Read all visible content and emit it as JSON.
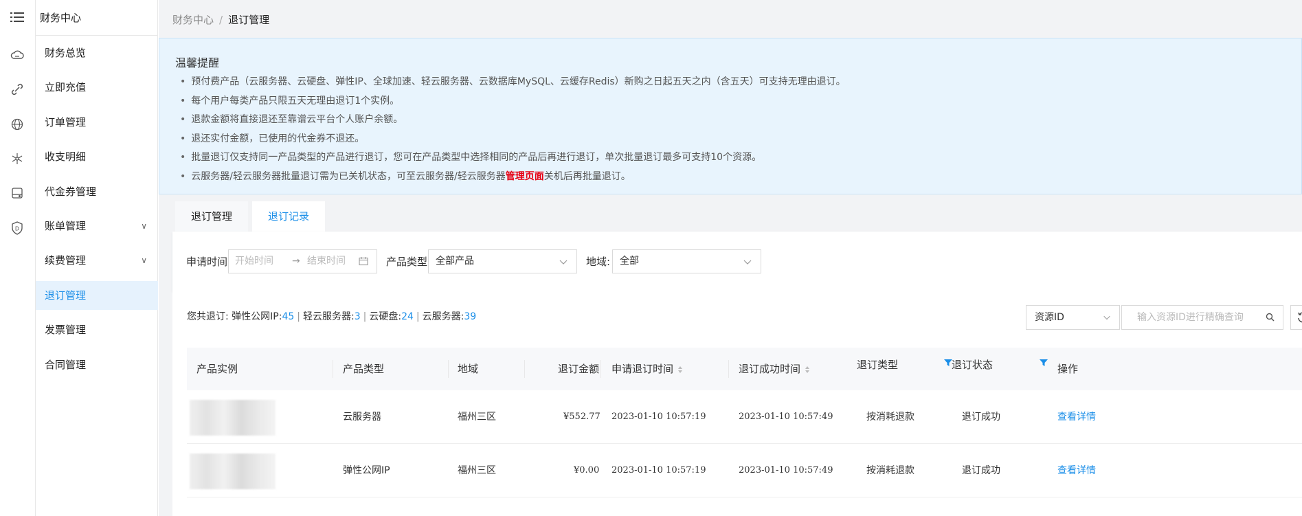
{
  "rail_icons": [
    "menu-icon",
    "cloud-icon",
    "link-icon",
    "globe-icon",
    "network-icon",
    "disk-icon",
    "shield-icon"
  ],
  "nav": {
    "title": "财务中心",
    "items": [
      {
        "label": "财务总览"
      },
      {
        "label": "立即充值"
      },
      {
        "label": "订单管理"
      },
      {
        "label": "收支明细"
      },
      {
        "label": "代金券管理"
      },
      {
        "label": "账单管理",
        "expand": "∨"
      },
      {
        "label": "续费管理",
        "expand": "∨"
      },
      {
        "label": "退订管理"
      },
      {
        "label": "发票管理"
      },
      {
        "label": "合同管理"
      }
    ]
  },
  "breadcrumb": {
    "root": "财务中心",
    "sep": "/",
    "current": "退订管理"
  },
  "notice": {
    "title": "温馨提醒",
    "items": [
      "预付费产品（云服务器、云硬盘、弹性IP、全球加速、轻云服务器、云数据库MySQL、云缓存Redis）新购之日起五天之内（含五天）可支持无理由退订。",
      "每个用户每类产品只限五天无理由退订1个实例。",
      "退款金额将直接退还至靠谱云平台个人账户余额。",
      "退还实付金额，已使用的代金券不退还。",
      "批量退订仅支持同一产品类型的产品进行退订，您可在产品类型中选择相同的产品后再进行退订，单次批量退订最多可支持10个资源。"
    ],
    "last_item": {
      "before": "云服务器/轻云服务器批量退订需为已关机状态，可至云服务器/轻云服务器",
      "highlight": "管理页面",
      "after": "关机后再批量退订。"
    }
  },
  "tabs": [
    {
      "label": "退订管理"
    },
    {
      "label": "退订记录"
    }
  ],
  "filter": {
    "time_label": "申请时间:",
    "start_placeholder": "开始时间",
    "arrow": "→",
    "end_placeholder": "结束时间",
    "type_label": "产品类型:",
    "type_value": "全部产品",
    "region_label": "地域:",
    "region_value": "全部"
  },
  "summary": {
    "prefix": "您共退订:",
    "items": [
      {
        "name": "弹性公网IP:",
        "count": "45"
      },
      {
        "name": "轻云服务器:",
        "count": "3"
      },
      {
        "name": "云硬盘:",
        "count": "24"
      },
      {
        "name": "云服务器:",
        "count": "39"
      }
    ],
    "separator": "|"
  },
  "search": {
    "field_value": "资源ID",
    "placeholder": "输入资源ID进行精确查询"
  },
  "table": {
    "headers": {
      "instance": "产品实例",
      "type": "产品类型",
      "region": "地域",
      "amount": "退订金额",
      "apply_time": "申请退订时间",
      "success_time": "退订成功时间",
      "refund_type": "退订类型",
      "status": "退订状态",
      "action": "操作"
    },
    "rows": [
      {
        "type": "云服务器",
        "region": "福州三区",
        "amount": "¥552.77",
        "apply_time": "2023-01-10 10:57:19",
        "success_time": "2023-01-10 10:57:49",
        "refund_type": "按消耗退款",
        "status": "退订成功",
        "action": "查看详情"
      },
      {
        "type": "弹性公网IP",
        "region": "福州三区",
        "amount": "¥0.00",
        "apply_time": "2023-01-10 10:57:19",
        "success_time": "2023-01-10 10:57:49",
        "refund_type": "按消耗退款",
        "status": "退订成功",
        "action": "查看详情"
      }
    ]
  },
  "colors": {
    "accent": "#1a8ee8",
    "notice_bg": "#e8f4fd",
    "highlight": "#e60012"
  }
}
